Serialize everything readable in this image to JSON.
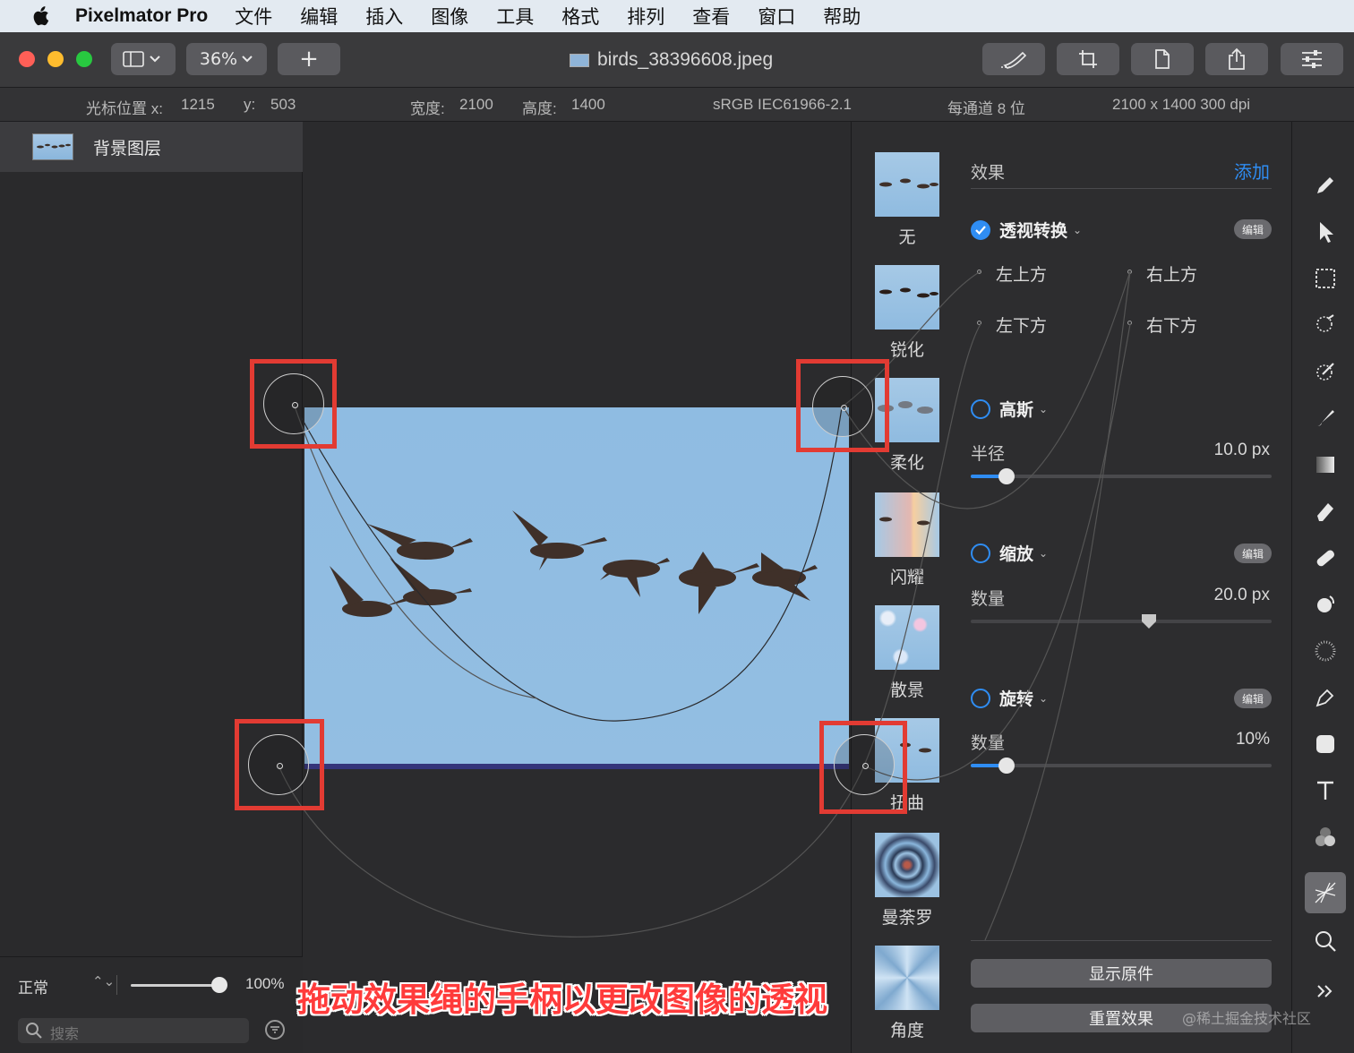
{
  "menubar": {
    "app_name": "Pixelmator Pro",
    "items": [
      "文件",
      "编辑",
      "插入",
      "图像",
      "工具",
      "格式",
      "排列",
      "查看",
      "窗口",
      "帮助"
    ]
  },
  "toolbar": {
    "zoom": "36%",
    "add_label": "+",
    "document_title": "birds_38396608.jpeg"
  },
  "infobar": {
    "cursor_x_label": "光标位置 x:",
    "cursor_x": "1215",
    "cursor_y_label": "y:",
    "cursor_y": "503",
    "width_label": "宽度:",
    "width": "2100",
    "height_label": "高度:",
    "height": "1400",
    "color_profile": "sRGB IEC61966-2.1",
    "bit_depth": "每通道 8 位",
    "resolution": "2100 x 1400 300 dpi"
  },
  "layers": {
    "items": [
      {
        "name": "背景图层"
      }
    ],
    "blend_mode": "正常",
    "opacity": "100%",
    "opacity_fraction": 1.0,
    "search_placeholder": "搜索"
  },
  "effects_browser": {
    "items": [
      {
        "label": "无"
      },
      {
        "label": "锐化"
      },
      {
        "label": "柔化"
      },
      {
        "label": "闪耀"
      },
      {
        "label": "散景"
      },
      {
        "label": "扭曲"
      },
      {
        "label": "曼荼罗"
      },
      {
        "label": "角度"
      }
    ]
  },
  "inspector": {
    "title": "效果",
    "add_label": "添加",
    "edit_label": "编辑",
    "perspective": {
      "name": "透视转换",
      "enabled": true,
      "top_left": "左上方",
      "top_right": "右上方",
      "bottom_left": "左下方",
      "bottom_right": "右下方"
    },
    "gaussian": {
      "name": "高斯",
      "enabled": false,
      "param_label": "半径",
      "param_value": "10.0 px",
      "level": 0.12
    },
    "zoom": {
      "name": "缩放",
      "enabled": false,
      "param_label": "数量",
      "param_value": "20.0 px",
      "level": 0.59
    },
    "rotate": {
      "name": "旋转",
      "enabled": false,
      "param_label": "数量",
      "param_value": "10%",
      "level": 0.12
    },
    "show_original": "显示原件",
    "reset_effects": "重置效果"
  },
  "tools": [
    "style-icon",
    "arrange-icon",
    "select-icon",
    "quick-select-icon",
    "color-adjust-icon",
    "paint-icon",
    "gradient-icon",
    "erase-icon",
    "retouch-icon",
    "distort-icon",
    "blur-pattern-icon",
    "pen-icon",
    "shape-icon",
    "type-icon",
    "color-icon",
    "effects-icon",
    "zoom-icon",
    "more-icon"
  ],
  "caption": "拖动效果绳的手柄以更改图像的透视",
  "watermark": "@稀土掘金技术社区",
  "colors": {
    "accent": "#2f8df3",
    "highlight_box": "#e23b33",
    "caption": "#ff3b3b"
  }
}
